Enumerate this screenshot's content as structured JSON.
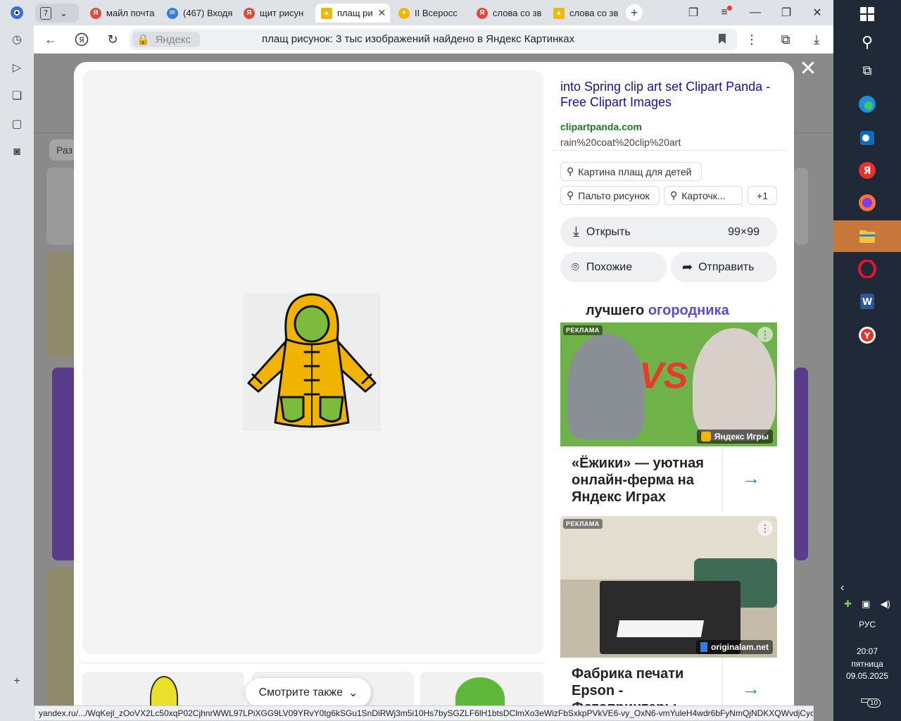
{
  "browser": {
    "tab_count": "7",
    "tabs": [
      {
        "label": "майл почта",
        "favicon": "yandex-icon"
      },
      {
        "label": "(467) Входя",
        "favicon": "mail-icon"
      },
      {
        "label": "щит рисун",
        "favicon": "yandex-icon"
      },
      {
        "label": "плащ ри",
        "favicon": "image-icon",
        "active": true
      },
      {
        "label": "II Всеросс",
        "favicon": "star-icon"
      },
      {
        "label": "слова со зв",
        "favicon": "yandex-icon"
      },
      {
        "label": "слова со зв",
        "favicon": "image-icon"
      }
    ],
    "address_chip": "Яндекс",
    "address_text": "плащ рисунок: 3 тыс изображений найдено в Яндекс Картинках",
    "status_url": "yandex.ru/.../WqKejl_zOoVX2Lc50xqP02CjhnrWWL97LPiXGG9LV09YRvY0tg6kSGu1SnDiRWj3m5i10Hs7bySGZLF6lH1btsDClmXo3eWizFbSxkpPVkVE6-vy_OxN6-vmYuleH4wdr6bFyNmQjNDKXQWvdjCyc."
  },
  "background": {
    "filter_button": "Раз"
  },
  "viewer": {
    "source_title": "into Spring clip art set Clipart Panda - Free Clipart Images",
    "source_domain": "clipartpanda.com",
    "source_path": "rain%20coat%20clip%20art",
    "tags": [
      "Картина плащ для детей",
      "Пальто рисунок",
      "Карточк..."
    ],
    "more_tags": "+1",
    "open_label": "Открыть",
    "image_size": "99×99",
    "similar_label": "Похожие",
    "share_label": "Отправить",
    "see_also_label": "Смотрите также"
  },
  "ads": [
    {
      "label": "РЕКЛАМА",
      "banner_text": "лучшего огородника",
      "banner_text_accent": "огородника",
      "badge_vs": "VS",
      "source": "Яндекс Игры",
      "text": "«Ёжики» — уютная онлайн-ферма на Яндекс Играх"
    },
    {
      "label": "РЕКЛАМА",
      "source": "originalam.net",
      "text": "Фабрика печати Epson - Фотопринтеры..."
    }
  ],
  "taskbar": {
    "lang": "РУС",
    "time": "20:07",
    "weekday": "пятница",
    "date": "09.05.2025",
    "notifications": "10"
  },
  "colors": {
    "link": "#1a0dab",
    "domain": "#1b7a1b",
    "accent": "#2f7de1",
    "taskbar_active": "#c7773a"
  }
}
